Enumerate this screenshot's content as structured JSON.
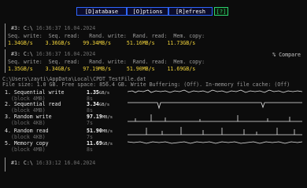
{
  "menu": {
    "database": "[D]atabase",
    "options": "[O]ptions",
    "refresh": "[R]efresh",
    "help": "[?]"
  },
  "results": [
    {
      "id": "#3: C:\\",
      "timestamp": "16:36:37 16.04.2024",
      "headers": "Seq. write:  Seq. read:   Rand. write:  Rand. read:  Mem. copy:",
      "values": "1.34GB/s    3.36GB/s    99.34MB/s     51.16MB/s    11.73GB/s"
    },
    {
      "id": "#3: C:\\",
      "timestamp": "16:36:37 16.04.2024",
      "headers": "Seq. write:  Seq. read:   Rand. write:  Rand. read:  Mem. copy:",
      "values": "1.35GB/s    3.34GB/s    97.19MB/s     51.90MB/s    11.69GB/s"
    }
  ],
  "compare_label": "% Compare",
  "file_path": "C:\\Users\\zayti\\AppData\\Local\\CPDT_TestFile.dat",
  "file_info": "File size: 1.0 GB. Free space: 856.4 GB. Write Buffering: (Off). In-memory file cache: (Off)",
  "tests": [
    {
      "label": "1. Sequential write",
      "sub": "(block 4MB)",
      "value": "1.35",
      "unit": "GB/s",
      "time": "8s"
    },
    {
      "label": "2. Sequential read",
      "sub": "(block 4MB)",
      "value": "3.34",
      "unit": "GB/s",
      "time": "8s"
    },
    {
      "label": "3. Random write",
      "sub": "(block 4KB)",
      "value": "97.19",
      "unit": "MB/s",
      "time": "7s"
    },
    {
      "label": "4. Random read",
      "sub": "(block 4KB)",
      "value": "51.90",
      "unit": "MB/s",
      "time": "7s"
    },
    {
      "label": "5. Memory copy",
      "sub": "(block 4MB)",
      "value": "11.69",
      "unit": "GB/s",
      "time": "8s"
    }
  ],
  "bottom_result": {
    "id": "#1: C:\\",
    "timestamp": "16:33:12 16.04.2024"
  }
}
